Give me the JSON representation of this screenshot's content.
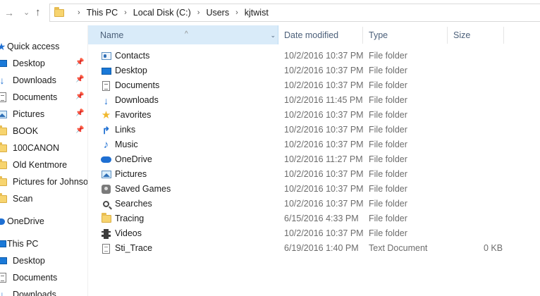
{
  "breadcrumb": [
    "This PC",
    "Local Disk (C:)",
    "Users",
    "kjtwist"
  ],
  "sidebar": {
    "quick_access": "Quick access",
    "pinned": [
      {
        "label": "Desktop",
        "icon": "desktop-icon"
      },
      {
        "label": "Downloads",
        "icon": "download-icon"
      },
      {
        "label": "Documents",
        "icon": "documents-icon"
      },
      {
        "label": "Pictures",
        "icon": "pictures-icon"
      },
      {
        "label": "BOOK",
        "icon": "folder-icon"
      }
    ],
    "recent": [
      {
        "label": "100CANON",
        "icon": "folder-icon"
      },
      {
        "label": "Old Kentmore",
        "icon": "folder-icon"
      },
      {
        "label": "Pictures for Johnson",
        "icon": "folder-icon"
      },
      {
        "label": "Scan",
        "icon": "folder-icon"
      }
    ],
    "onedrive": "OneDrive",
    "this_pc": "This PC",
    "this_pc_items": [
      "Desktop",
      "Documents",
      "Downloads"
    ],
    "pin_glyph": "📌"
  },
  "columns": {
    "name": "Name",
    "date": "Date modified",
    "type": "Type",
    "size": "Size"
  },
  "files": [
    {
      "name": "Contacts",
      "date": "10/2/2016 10:37 PM",
      "type": "File folder",
      "size": "",
      "icon": "contacts-icon"
    },
    {
      "name": "Desktop",
      "date": "10/2/2016 10:37 PM",
      "type": "File folder",
      "size": "",
      "icon": "desktop-icon"
    },
    {
      "name": "Documents",
      "date": "10/2/2016 10:37 PM",
      "type": "File folder",
      "size": "",
      "icon": "documents-icon"
    },
    {
      "name": "Downloads",
      "date": "10/2/2016 11:45 PM",
      "type": "File folder",
      "size": "",
      "icon": "download-icon"
    },
    {
      "name": "Favorites",
      "date": "10/2/2016 10:37 PM",
      "type": "File folder",
      "size": "",
      "icon": "star-icon"
    },
    {
      "name": "Links",
      "date": "10/2/2016 10:37 PM",
      "type": "File folder",
      "size": "",
      "icon": "links-icon"
    },
    {
      "name": "Music",
      "date": "10/2/2016 10:37 PM",
      "type": "File folder",
      "size": "",
      "icon": "music-icon"
    },
    {
      "name": "OneDrive",
      "date": "10/2/2016 11:27 PM",
      "type": "File folder",
      "size": "",
      "icon": "onedrive-icon"
    },
    {
      "name": "Pictures",
      "date": "10/2/2016 10:37 PM",
      "type": "File folder",
      "size": "",
      "icon": "pictures-icon"
    },
    {
      "name": "Saved Games",
      "date": "10/2/2016 10:37 PM",
      "type": "File folder",
      "size": "",
      "icon": "games-icon"
    },
    {
      "name": "Searches",
      "date": "10/2/2016 10:37 PM",
      "type": "File folder",
      "size": "",
      "icon": "search-icon"
    },
    {
      "name": "Tracing",
      "date": "6/15/2016 4:33 PM",
      "type": "File folder",
      "size": "",
      "icon": "folder-icon"
    },
    {
      "name": "Videos",
      "date": "10/2/2016 10:37 PM",
      "type": "File folder",
      "size": "",
      "icon": "videos-icon"
    },
    {
      "name": "Sti_Trace",
      "date": "6/19/2016 1:40 PM",
      "type": "Text Document",
      "size": "0 KB",
      "icon": "text-file-icon"
    }
  ]
}
